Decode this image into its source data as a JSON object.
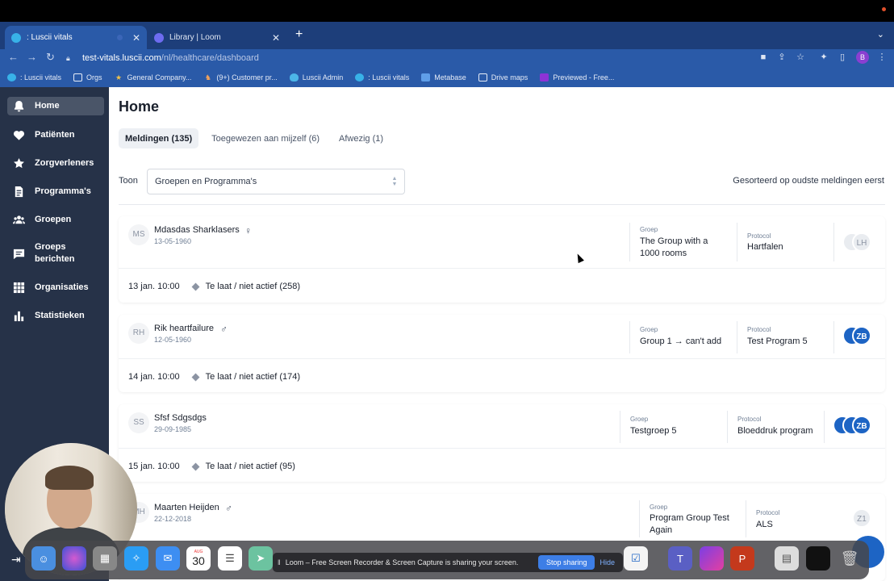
{
  "browser": {
    "tabs": [
      {
        "title": ": Luscii vitals",
        "active": true
      },
      {
        "title": "Library | Loom",
        "active": false
      }
    ],
    "url": {
      "host": "test-vitals.luscii.com",
      "path": "/nl/healthcare/dashboard"
    },
    "bookmarks": [
      {
        "label": ": Luscii vitals",
        "icon": "luscii-icon"
      },
      {
        "label": "Orgs",
        "icon": "folder-icon"
      },
      {
        "label": "General Company...",
        "icon": "star-icon"
      },
      {
        "label": "(9+) Customer pr...",
        "icon": "customer-icon"
      },
      {
        "label": "Luscii Admin",
        "icon": "shield-icon"
      },
      {
        "label": ": Luscii vitals",
        "icon": "luscii-icon"
      },
      {
        "label": "Metabase",
        "icon": "metabase-icon"
      },
      {
        "label": "Drive maps",
        "icon": "folder-icon"
      },
      {
        "label": "Previewed - Free...",
        "icon": "previewed-icon"
      }
    ],
    "profile_initial": "B"
  },
  "sidebar": {
    "items": [
      {
        "label": "Home",
        "icon": "bell-icon",
        "active": true
      },
      {
        "label": "Patiënten",
        "icon": "heart-icon",
        "active": false
      },
      {
        "label": "Zorgverleners",
        "icon": "star-icon",
        "active": false
      },
      {
        "label": "Programma's",
        "icon": "document-icon",
        "active": false
      },
      {
        "label": "Groepen",
        "icon": "users-icon",
        "active": false
      },
      {
        "label": "Groeps berichten",
        "icon": "message-icon",
        "active": false
      },
      {
        "label": "Organisaties",
        "icon": "grid-icon",
        "active": false
      },
      {
        "label": "Statistieken",
        "icon": "bar-chart-icon",
        "active": false
      }
    ]
  },
  "main": {
    "title": "Home",
    "tabs": [
      {
        "label": "Meldingen (135)",
        "active": true
      },
      {
        "label": "Toegewezen aan mijzelf (6)",
        "active": false
      },
      {
        "label": "Afwezig (1)",
        "active": false
      }
    ],
    "filter": {
      "label": "Toon",
      "value": "Groepen en Programma's"
    },
    "sort_text": "Gesorteerd op oudste meldingen eerst",
    "group_label": "Groep",
    "protocol_label": "Protocol",
    "cards": [
      {
        "initials": "MS",
        "name": "Mdasdas Sharklasers",
        "gender_icon": "female-icon",
        "birthdate": "13-05-1960",
        "group": "The Group with a 1000 rooms",
        "protocol": "Hartfalen",
        "caregiver": "LH",
        "caregiver_style": "gray",
        "alert_date": "13 jan. 10:00",
        "alert_text": "Te laat / niet actief (258)"
      },
      {
        "initials": "RH",
        "name": "Rik heartfailure",
        "gender_icon": "male-icon",
        "birthdate": "12-05-1960",
        "group": "Group 1 → can't add",
        "protocol": "Test Program 5",
        "caregiver": "ZB",
        "caregiver_style": "blue",
        "alert_date": "14 jan. 10:00",
        "alert_text": "Te laat / niet actief (174)"
      },
      {
        "initials": "SS",
        "name": "Sfsf Sdgsdgs",
        "gender_icon": "",
        "birthdate": "29-09-1985",
        "group": "Testgroep 5",
        "protocol": "Bloeddruk program",
        "caregiver": "ZB",
        "caregiver_style": "blue",
        "alert_date": "15 jan. 10:00",
        "alert_text": "Te laat / niet actief (95)"
      },
      {
        "initials": "MH",
        "name": "Maarten Heijden",
        "gender_icon": "male-icon",
        "birthdate": "22-12-2018",
        "group": "Program Group Test Again",
        "protocol": "ALS",
        "caregiver": "Z1",
        "caregiver_style": "gray"
      }
    ]
  },
  "loom": {
    "message": "Loom – Free Screen Recorder & Screen Capture is sharing your screen.",
    "stop_label": "Stop sharing",
    "hide_label": "Hide"
  },
  "dock": {
    "calendar_month": "AUG",
    "calendar_day": "30"
  },
  "colors": {
    "sidebar_bg": "#263248",
    "accent_blue": "#1d64c4",
    "chrome_blue": "#2a5aa8"
  }
}
